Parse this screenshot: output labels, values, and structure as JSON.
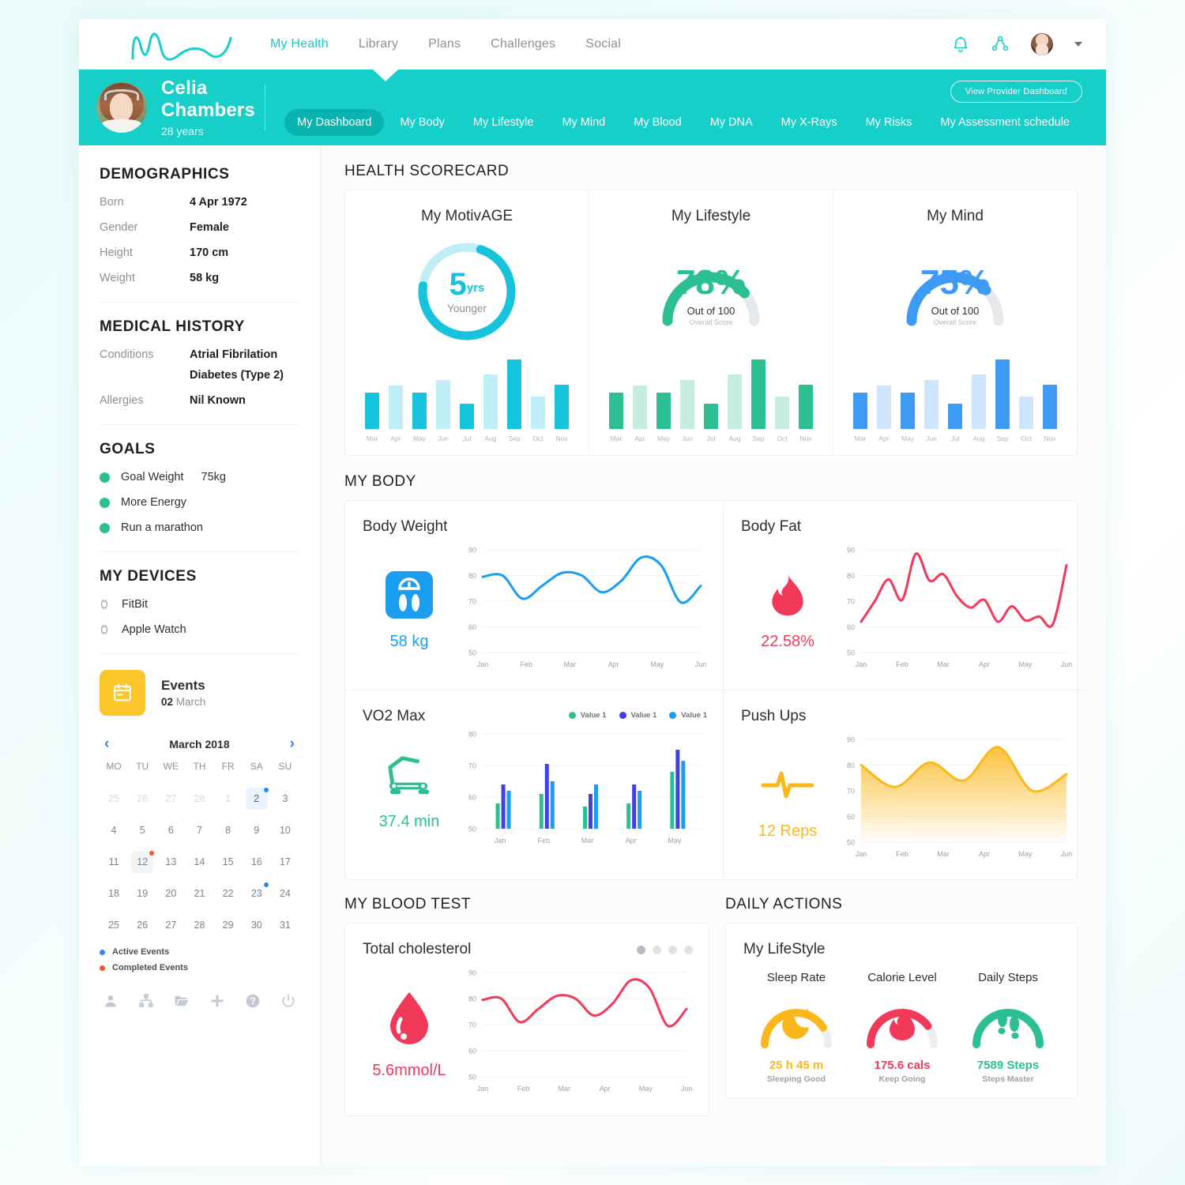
{
  "header": {
    "logo_name": "wave-logo",
    "nav": [
      {
        "label": "My Health",
        "active": true
      },
      {
        "label": "Library",
        "active": false
      },
      {
        "label": "Plans",
        "active": false
      },
      {
        "label": "Challenges",
        "active": false
      },
      {
        "label": "Social",
        "active": false
      }
    ],
    "icons": [
      "bell-icon",
      "share-icon"
    ],
    "accent": "#17cfc9"
  },
  "profile": {
    "name": "Celia Chambers",
    "age": "28 years",
    "provider_button": "View Provider Dashboard",
    "tabs": [
      {
        "label": "My Dashboard",
        "active": true
      },
      {
        "label": "My Body",
        "active": false
      },
      {
        "label": "My Lifestyle",
        "active": false
      },
      {
        "label": "My Mind",
        "active": false
      },
      {
        "label": "My Blood",
        "active": false
      },
      {
        "label": "My DNA",
        "active": false
      },
      {
        "label": "My X-Rays",
        "active": false
      },
      {
        "label": "My Risks",
        "active": false
      },
      {
        "label": "My Assessment schedule",
        "active": false
      }
    ]
  },
  "sidebar": {
    "demographics": {
      "title": "DEMOGRAPHICS",
      "rows": [
        {
          "key": "Born",
          "value": "4 Apr 1972"
        },
        {
          "key": "Gender",
          "value": "Female"
        },
        {
          "key": "Height",
          "value": "170 cm"
        },
        {
          "key": "Weight",
          "value": "58 kg"
        }
      ]
    },
    "medical_history": {
      "title": "MEDICAL HISTORY",
      "conditions_key": "Conditions",
      "conditions": [
        "Atrial Fibrilation",
        "Diabetes (Type 2)"
      ],
      "allergies_key": "Allergies",
      "allergies": "Nil Known"
    },
    "goals": {
      "title": "GOALS",
      "items": [
        {
          "label": "Goal Weight",
          "value": "75kg"
        },
        {
          "label": "More Energy",
          "value": ""
        },
        {
          "label": "Run a marathon",
          "value": ""
        }
      ]
    },
    "devices": {
      "title": "MY DEVICES",
      "items": [
        "FitBit",
        "Apple Watch"
      ]
    },
    "events": {
      "title": "Events",
      "date_num": "02",
      "date_month": "March"
    },
    "calendar": {
      "month_label": "March 2018",
      "prev": "‹",
      "next": "›",
      "weekdays": [
        "MO",
        "TU",
        "WE",
        "TH",
        "FR",
        "SA",
        "SU"
      ],
      "weeks": [
        [
          {
            "d": "25",
            "mute": true
          },
          {
            "d": "26",
            "mute": true
          },
          {
            "d": "27",
            "mute": true
          },
          {
            "d": "28",
            "mute": true
          },
          {
            "d": "1",
            "mute": true
          },
          {
            "d": "2",
            "sel": true,
            "dot": "blue"
          },
          {
            "d": "3"
          }
        ],
        [
          {
            "d": "4"
          },
          {
            "d": "5"
          },
          {
            "d": "6"
          },
          {
            "d": "7"
          },
          {
            "d": "8"
          },
          {
            "d": "9"
          },
          {
            "d": "10"
          }
        ],
        [
          {
            "d": "11"
          },
          {
            "d": "12",
            "comp": true,
            "dot": "red"
          },
          {
            "d": "13"
          },
          {
            "d": "14"
          },
          {
            "d": "15"
          },
          {
            "d": "16"
          },
          {
            "d": "17"
          }
        ],
        [
          {
            "d": "18"
          },
          {
            "d": "19"
          },
          {
            "d": "20"
          },
          {
            "d": "21"
          },
          {
            "d": "22"
          },
          {
            "d": "23",
            "dot": "blue"
          },
          {
            "d": "24"
          }
        ],
        [
          {
            "d": "25"
          },
          {
            "d": "26"
          },
          {
            "d": "27"
          },
          {
            "d": "28"
          },
          {
            "d": "29"
          },
          {
            "d": "30"
          },
          {
            "d": "31"
          }
        ]
      ],
      "legend": [
        {
          "label": "Active Events",
          "color": "#2f86f6"
        },
        {
          "label": "Completed Events",
          "color": "#f8552b"
        }
      ]
    },
    "toolbar_icons": [
      "user-icon",
      "sitemap-icon",
      "folder-icon",
      "plus-icon",
      "help-icon",
      "power-icon"
    ]
  },
  "main": {
    "scorecard_title": "HEALTH SCORECARD",
    "body_title": "MY BODY",
    "blood_title": "MY BLOOD TEST",
    "actions_title": "DAILY ACTIONS"
  },
  "chart_data": [
    {
      "type": "bar",
      "title": "My MotivAGE",
      "center_value": "5",
      "center_unit": "yrs",
      "center_sub": "Younger",
      "ring_percent": 72,
      "color": "#16c3dd",
      "color_light": "#bfeef7",
      "categories": [
        "Mar",
        "Apr",
        "May",
        "Jun",
        "Jul",
        "Aug",
        "Sep",
        "Oct",
        "Nov"
      ],
      "values": [
        46,
        55,
        46,
        62,
        32,
        69,
        88,
        41,
        56
      ],
      "ylim": [
        0,
        100
      ],
      "grid": false,
      "legend": "none"
    },
    {
      "type": "bar",
      "title": "My Lifestyle",
      "center_value": "78%",
      "center_sub": "Out of 100",
      "center_sub2": "Overall Score",
      "ring_percent": 78,
      "color": "#2bbf93",
      "color_light": "#c6ece0",
      "categories": [
        "Mar",
        "Apr",
        "May",
        "Jun",
        "Jul",
        "Aug",
        "Sep",
        "Oct",
        "Nov"
      ],
      "values": [
        46,
        55,
        46,
        62,
        32,
        69,
        88,
        41,
        56
      ],
      "ylim": [
        0,
        100
      ],
      "grid": false,
      "legend": "none"
    },
    {
      "type": "bar",
      "title": "My Mind",
      "center_value": "75%",
      "center_sub": "Out of 100",
      "center_sub2": "Overall Score",
      "ring_percent": 75,
      "color": "#3d9bf5",
      "color_light": "#cfe5fb",
      "categories": [
        "Mar",
        "Apr",
        "May",
        "Jun",
        "Jul",
        "Aug",
        "Sep",
        "Oct",
        "Nov"
      ],
      "values": [
        46,
        55,
        46,
        62,
        32,
        69,
        88,
        41,
        56
      ],
      "ylim": [
        0,
        100
      ],
      "grid": false,
      "legend": "none"
    },
    {
      "type": "line",
      "title": "Body Weight",
      "value_label": "58 kg",
      "icon": "weight-scale-icon",
      "color": "#1b9df0",
      "x": [
        "Jan",
        "Feb",
        "Mar",
        "Apr",
        "May",
        "Jun"
      ],
      "yticks": [
        50,
        60,
        70,
        80,
        90
      ],
      "ylim": [
        50,
        90
      ],
      "values": [
        79.5,
        80,
        71,
        76,
        81,
        80,
        73.5,
        78,
        87,
        84,
        69.5,
        76
      ],
      "grid": true,
      "legend": "none"
    },
    {
      "type": "line",
      "title": "Body Fat",
      "value_label": "22.58%",
      "icon": "flame-icon",
      "color": "#f2395a",
      "x": [
        "Jan",
        "Feb",
        "Mar",
        "Apr",
        "May",
        "Jun"
      ],
      "yticks": [
        50,
        60,
        70,
        80,
        90
      ],
      "ylim": [
        50,
        90
      ],
      "values": [
        62,
        70,
        78.5,
        70.5,
        88.5,
        78,
        80.5,
        72,
        67.5,
        70.5,
        62,
        68,
        62.5,
        64,
        61,
        84
      ],
      "grid": true,
      "legend": "none"
    },
    {
      "type": "bar",
      "title": "VO2 Max",
      "value_label": "37.4 min",
      "icon": "treadmill-icon",
      "color": "#2bbf93",
      "x": [
        "Jan",
        "Feb",
        "Mar",
        "Apr",
        "May"
      ],
      "yticks": [
        50,
        60,
        70,
        80
      ],
      "ylim": [
        50,
        80
      ],
      "grouped": true,
      "series": [
        {
          "name": "Value 1",
          "color": "#2bbf93",
          "values": [
            58,
            61,
            57,
            58,
            68
          ]
        },
        {
          "name": "Value 1",
          "color": "#4040e8",
          "values": [
            64,
            70.5,
            61,
            64,
            75
          ]
        },
        {
          "name": "Value 1",
          "color": "#1b9df0",
          "values": [
            62,
            65,
            64,
            62,
            71.5
          ]
        }
      ],
      "grid": true,
      "legend": "top-right"
    },
    {
      "type": "area",
      "title": "Push Ups",
      "value_label": "12 Reps",
      "icon": "pulse-icon",
      "color": "#fcb81b",
      "x": [
        "Jan",
        "Feb",
        "Mar",
        "Apr",
        "May",
        "Jun"
      ],
      "yticks": [
        50,
        60,
        70,
        80,
        90
      ],
      "ylim": [
        50,
        90
      ],
      "values": [
        80,
        71.5,
        81,
        74,
        87,
        70,
        76.5
      ],
      "grid": true,
      "legend": "none"
    },
    {
      "type": "line",
      "title": "Total cholesterol",
      "value_label": "5.6mmol/L",
      "icon": "blood-drop-icon",
      "color": "#f2395a",
      "x": [
        "Jan",
        "Feb",
        "Mar",
        "Apr",
        "May",
        "Jun"
      ],
      "yticks": [
        50,
        60,
        70,
        80,
        90
      ],
      "ylim": [
        50,
        90
      ],
      "values": [
        79.5,
        80,
        71,
        76,
        81,
        80,
        73.5,
        78,
        87,
        84,
        69.5,
        76
      ],
      "grid": true,
      "legend": "none",
      "pager_dots": 4,
      "pager_active": 0
    }
  ],
  "lifestyle_panel": {
    "title": "My LifeStyle",
    "metrics": [
      {
        "label": "Sleep Rate",
        "value": "25 h 45 m",
        "sub": "Sleeping Good",
        "percent": 82,
        "color": "#fcb81b",
        "icon": "moon-icon"
      },
      {
        "label": "Calorie Level",
        "value": "175.6 cals",
        "sub": "Keep Going",
        "percent": 80,
        "color": "#f2395a",
        "icon": "flame-icon"
      },
      {
        "label": "Daily Steps",
        "value": "7589 Steps",
        "sub": "Steps Master",
        "percent": 100,
        "color": "#2bbf93",
        "icon": "footsteps-icon"
      }
    ]
  }
}
